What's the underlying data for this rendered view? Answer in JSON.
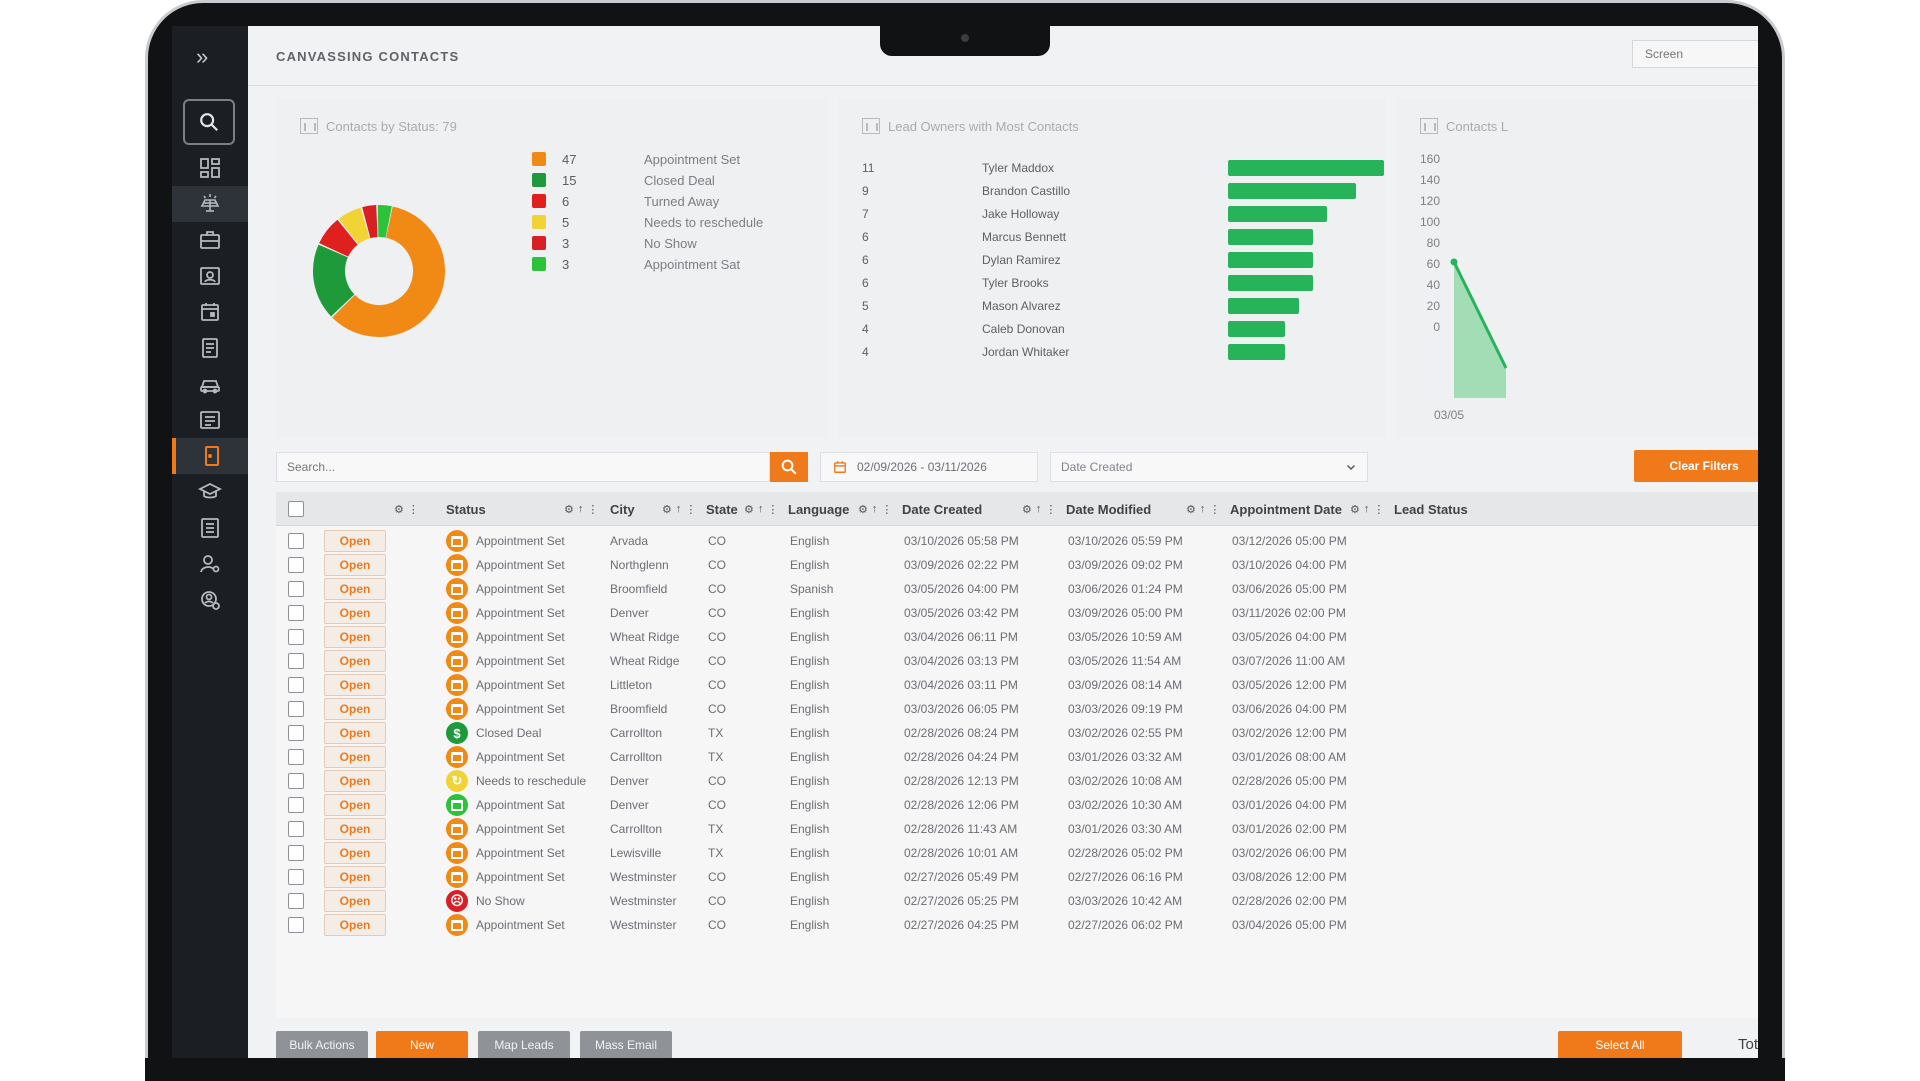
{
  "header": {
    "title": "CANVASSING CONTACTS",
    "screen_placeholder": "Screen"
  },
  "sidebar": {
    "items": [
      {
        "icon": "dashboard-icon"
      },
      {
        "icon": "solar-panel-icon"
      },
      {
        "icon": "briefcase-icon"
      },
      {
        "icon": "contact-card-icon"
      },
      {
        "icon": "calendar-icon"
      },
      {
        "icon": "document-icon"
      },
      {
        "icon": "car-icon"
      },
      {
        "icon": "list-icon"
      },
      {
        "icon": "door-icon"
      },
      {
        "icon": "graduation-cap-icon"
      },
      {
        "icon": "checklist-icon"
      },
      {
        "icon": "user-settings-icon"
      },
      {
        "icon": "shield-user-icon"
      }
    ]
  },
  "status_card": {
    "title": "Contacts by Status: 79",
    "legend": [
      {
        "count": "47",
        "label": "Appointment Set",
        "color": "#f08a14"
      },
      {
        "count": "15",
        "label": "Closed Deal",
        "color": "#1e9a3b"
      },
      {
        "count": "6",
        "label": "Turned Away",
        "color": "#e0201e"
      },
      {
        "count": "5",
        "label": "Needs to reschedule",
        "color": "#f2d335"
      },
      {
        "count": "3",
        "label": "No Show",
        "color": "#d91f26"
      },
      {
        "count": "3",
        "label": "Appointment Sat",
        "color": "#2cc23a"
      }
    ]
  },
  "owners_card": {
    "title": "Lead Owners with Most Contacts",
    "rows": [
      {
        "count": "11",
        "name": "Tyler Maddox"
      },
      {
        "count": "9",
        "name": "Brandon Castillo"
      },
      {
        "count": "7",
        "name": "Jake Holloway"
      },
      {
        "count": "6",
        "name": "Marcus Bennett"
      },
      {
        "count": "6",
        "name": "Dylan Ramirez"
      },
      {
        "count": "6",
        "name": "Tyler Brooks"
      },
      {
        "count": "5",
        "name": "Mason Alvarez"
      },
      {
        "count": "4",
        "name": "Caleb Donovan"
      },
      {
        "count": "4",
        "name": "Jordan Whitaker"
      }
    ]
  },
  "contacts_card": {
    "title": "Contacts L",
    "yticks": [
      "160",
      "140",
      "120",
      "100",
      "80",
      "60",
      "40",
      "20",
      "0"
    ],
    "xtick": "03/05"
  },
  "chart_data": [
    {
      "type": "pie",
      "title": "Contacts by Status: 79",
      "categories": [
        "Appointment Set",
        "Closed Deal",
        "Turned Away",
        "Needs to reschedule",
        "No Show",
        "Appointment Sat"
      ],
      "values": [
        47,
        15,
        6,
        5,
        3,
        3
      ],
      "colors": [
        "#f08a14",
        "#1e9a3b",
        "#e0201e",
        "#f2d335",
        "#d91f26",
        "#2cc23a"
      ]
    },
    {
      "type": "bar",
      "title": "Lead Owners with Most Contacts",
      "categories": [
        "Tyler Maddox",
        "Brandon Castillo",
        "Jake Holloway",
        "Marcus Bennett",
        "Dylan Ramirez",
        "Tyler Brooks",
        "Mason Alvarez",
        "Caleb Donovan",
        "Jordan Whitaker"
      ],
      "values": [
        11,
        9,
        7,
        6,
        6,
        6,
        5,
        4,
        4
      ],
      "orientation": "horizontal",
      "color": "#27b35a"
    },
    {
      "type": "area",
      "title": "Contacts L",
      "ylim": [
        0,
        160
      ],
      "color": "#27b35a"
    }
  ],
  "toolbar": {
    "search_placeholder": "Search...",
    "date_range": "02/09/2026 - 03/11/2026",
    "date_type": "Date Created",
    "clear_filters": "Clear Filters"
  },
  "table": {
    "headers": {
      "status": "Status",
      "city": "City",
      "state": "State",
      "language": "Language",
      "date_created": "Date Created",
      "date_modified": "Date Modified",
      "appointment_date": "Appointment Date",
      "lead_status": "Lead Status"
    },
    "open_label": "Open",
    "rows": [
      {
        "status": "Appointment Set",
        "icon": "calendar",
        "color": "#f08a14",
        "city": "Arvada",
        "state": "CO",
        "language": "English",
        "created": "03/10/2026 05:58 PM",
        "modified": "03/10/2026 05:59 PM",
        "appt": "03/12/2026 05:00 PM"
      },
      {
        "status": "Appointment Set",
        "icon": "calendar",
        "color": "#f08a14",
        "city": "Northglenn",
        "state": "CO",
        "language": "English",
        "created": "03/09/2026 02:22 PM",
        "modified": "03/09/2026 09:02 PM",
        "appt": "03/10/2026 04:00 PM"
      },
      {
        "status": "Appointment Set",
        "icon": "calendar",
        "color": "#f08a14",
        "city": "Broomfield",
        "state": "CO",
        "language": "Spanish",
        "created": "03/05/2026 04:00 PM",
        "modified": "03/06/2026 01:24 PM",
        "appt": "03/06/2026 05:00 PM"
      },
      {
        "status": "Appointment Set",
        "icon": "calendar",
        "color": "#f08a14",
        "city": "Denver",
        "state": "CO",
        "language": "English",
        "created": "03/05/2026 03:42 PM",
        "modified": "03/09/2026 05:00 PM",
        "appt": "03/11/2026 02:00 PM"
      },
      {
        "status": "Appointment Set",
        "icon": "calendar",
        "color": "#f08a14",
        "city": "Wheat Ridge",
        "state": "CO",
        "language": "English",
        "created": "03/04/2026 06:11 PM",
        "modified": "03/05/2026 10:59 AM",
        "appt": "03/05/2026 04:00 PM"
      },
      {
        "status": "Appointment Set",
        "icon": "calendar",
        "color": "#f08a14",
        "city": "Wheat Ridge",
        "state": "CO",
        "language": "English",
        "created": "03/04/2026 03:13 PM",
        "modified": "03/05/2026 11:54 AM",
        "appt": "03/07/2026 11:00 AM"
      },
      {
        "status": "Appointment Set",
        "icon": "calendar",
        "color": "#f08a14",
        "city": "Littleton",
        "state": "CO",
        "language": "English",
        "created": "03/04/2026 03:11 PM",
        "modified": "03/09/2026 08:14 AM",
        "appt": "03/05/2026 12:00 PM"
      },
      {
        "status": "Appointment Set",
        "icon": "calendar",
        "color": "#f08a14",
        "city": "Broomfield",
        "state": "CO",
        "language": "English",
        "created": "03/03/2026 06:05 PM",
        "modified": "03/03/2026 09:19 PM",
        "appt": "03/06/2026 04:00 PM"
      },
      {
        "status": "Closed Deal",
        "icon": "dollar",
        "color": "#1e9a3b",
        "city": "Carrollton",
        "state": "TX",
        "language": "English",
        "created": "02/28/2026 08:24 PM",
        "modified": "03/02/2026 02:55 PM",
        "appt": "03/02/2026 12:00 PM"
      },
      {
        "status": "Appointment Set",
        "icon": "calendar",
        "color": "#f08a14",
        "city": "Carrollton",
        "state": "TX",
        "language": "English",
        "created": "02/28/2026 04:24 PM",
        "modified": "03/01/2026 03:32 AM",
        "appt": "03/01/2026 08:00 AM"
      },
      {
        "status": "Needs to reschedule",
        "icon": "refresh",
        "color": "#f2d335",
        "city": "Denver",
        "state": "CO",
        "language": "English",
        "created": "02/28/2026 12:13 PM",
        "modified": "03/02/2026 10:08 AM",
        "appt": "02/28/2026 05:00 PM"
      },
      {
        "status": "Appointment Sat",
        "icon": "calendar",
        "color": "#2cc23a",
        "city": "Denver",
        "state": "CO",
        "language": "English",
        "created": "02/28/2026 12:06 PM",
        "modified": "03/02/2026 10:30 AM",
        "appt": "03/01/2026 04:00 PM"
      },
      {
        "status": "Appointment Set",
        "icon": "calendar",
        "color": "#f08a14",
        "city": "Carrollton",
        "state": "TX",
        "language": "English",
        "created": "02/28/2026 11:43 AM",
        "modified": "03/01/2026 03:30 AM",
        "appt": "03/01/2026 02:00 PM"
      },
      {
        "status": "Appointment Set",
        "icon": "calendar",
        "color": "#f08a14",
        "city": "Lewisville",
        "state": "TX",
        "language": "English",
        "created": "02/28/2026 10:01 AM",
        "modified": "02/28/2026 05:02 PM",
        "appt": "03/02/2026 06:00 PM"
      },
      {
        "status": "Appointment Set",
        "icon": "calendar",
        "color": "#f08a14",
        "city": "Westminster",
        "state": "CO",
        "language": "English",
        "created": "02/27/2026 05:49 PM",
        "modified": "02/27/2026 06:16 PM",
        "appt": "03/08/2026 12:00 PM"
      },
      {
        "status": "No Show",
        "icon": "sad",
        "color": "#d91f26",
        "city": "Westminster",
        "state": "CO",
        "language": "English",
        "created": "02/27/2026 05:25 PM",
        "modified": "03/03/2026 10:42 AM",
        "appt": "02/28/2026 02:00 PM"
      },
      {
        "status": "Appointment Set",
        "icon": "calendar",
        "color": "#f08a14",
        "city": "Westminster",
        "state": "CO",
        "language": "English",
        "created": "02/27/2026 04:25 PM",
        "modified": "02/27/2026 06:02 PM",
        "appt": "03/04/2026 05:00 PM"
      }
    ]
  },
  "footer": {
    "bulk_actions": "Bulk Actions",
    "new": "New",
    "map_leads": "Map Leads",
    "mass_email": "Mass Email",
    "select_all": "Select All",
    "total": "Tota"
  }
}
